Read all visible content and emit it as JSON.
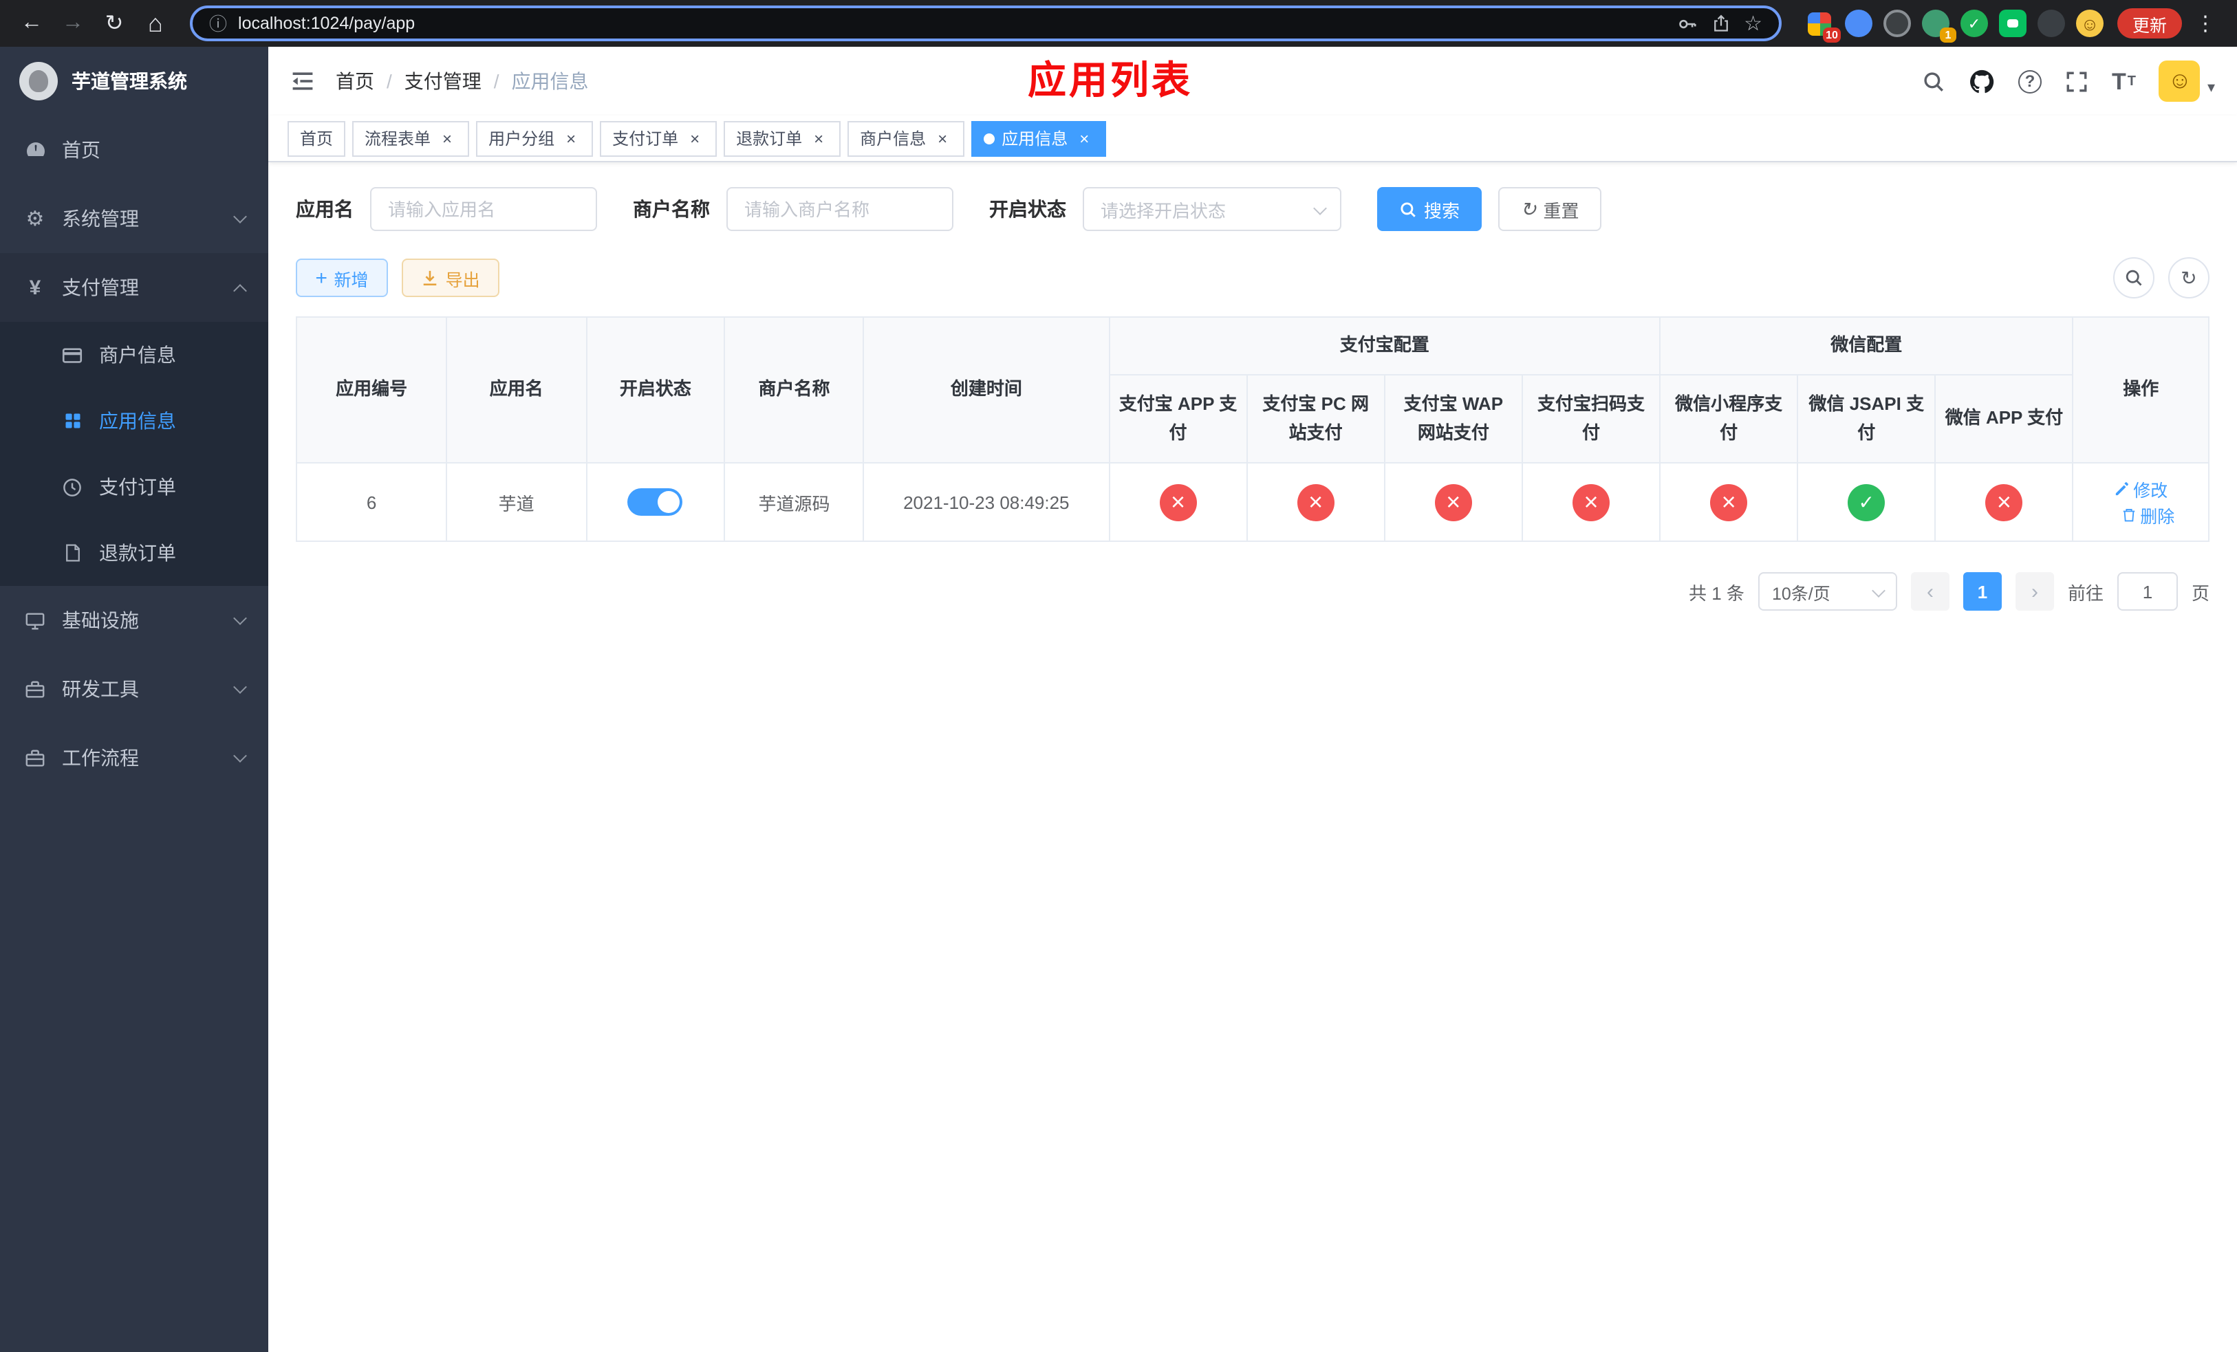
{
  "colors": {
    "accent": "#409eff",
    "danger": "#f35252",
    "success": "#2dbd5f",
    "warning": "#e6a23c",
    "title_red": "#f40d0d",
    "update_red": "#d7382e"
  },
  "browser": {
    "url": "localhost:1024/pay/app",
    "update_button": "更新",
    "ext_badge_a": "10",
    "ext_badge_b": "1"
  },
  "sidebar": {
    "app_title": "芋道管理系统",
    "items": [
      {
        "label": "首页"
      },
      {
        "label": "系统管理"
      },
      {
        "label": "支付管理"
      },
      {
        "label": "基础设施"
      },
      {
        "label": "研发工具"
      },
      {
        "label": "工作流程"
      }
    ],
    "submenu": [
      {
        "label": "商户信息"
      },
      {
        "label": "应用信息"
      },
      {
        "label": "支付订单"
      },
      {
        "label": "退款订单"
      }
    ]
  },
  "header": {
    "breadcrumb": [
      {
        "label": "首页"
      },
      {
        "label": "支付管理"
      },
      {
        "label": "应用信息"
      }
    ],
    "page_title": "应用列表"
  },
  "tabs": [
    {
      "label": "首页"
    },
    {
      "label": "流程表单"
    },
    {
      "label": "用户分组"
    },
    {
      "label": "支付订单"
    },
    {
      "label": "退款订单"
    },
    {
      "label": "商户信息"
    },
    {
      "label": "应用信息"
    }
  ],
  "filters": {
    "app_name_label": "应用名",
    "app_name_placeholder": "请输入应用名",
    "merchant_label": "商户名称",
    "merchant_placeholder": "请输入商户名称",
    "status_label": "开启状态",
    "status_placeholder": "请选择开启状态",
    "search_button": "搜索",
    "reset_button": "重置"
  },
  "toolbar": {
    "add_button": "新增",
    "export_button": "导出"
  },
  "table": {
    "col_app_id": "应用编号",
    "col_app_name": "应用名",
    "col_status": "开启状态",
    "col_merchant": "商户名称",
    "col_created": "创建时间",
    "group_alipay": "支付宝配置",
    "group_wechat": "微信配置",
    "col_alipay_app": "支付宝 APP 支付",
    "col_alipay_pc": "支付宝 PC 网站支付",
    "col_alipay_wap": "支付宝 WAP 网站支付",
    "col_alipay_qr": "支付宝扫码支付",
    "col_wx_mini": "微信小程序支付",
    "col_wx_jsapi": "微信 JSAPI 支付",
    "col_wx_app": "微信 APP 支付",
    "col_action": "操作",
    "rows": [
      {
        "app_id": "6",
        "app_name": "芋道",
        "status_on": true,
        "merchant": "芋道源码",
        "created": "2021-10-23 08:49:25",
        "alipay_app": false,
        "alipay_pc": false,
        "alipay_wap": false,
        "alipay_qr": false,
        "wx_mini": false,
        "wx_jsapi": true,
        "wx_app": false,
        "edit_label": "修改",
        "delete_label": "删除"
      }
    ]
  },
  "pagination": {
    "total": "共 1 条",
    "page_size": "10条/页",
    "page": "1",
    "goto_label": "前往",
    "goto_value": "1",
    "unit": "页"
  }
}
